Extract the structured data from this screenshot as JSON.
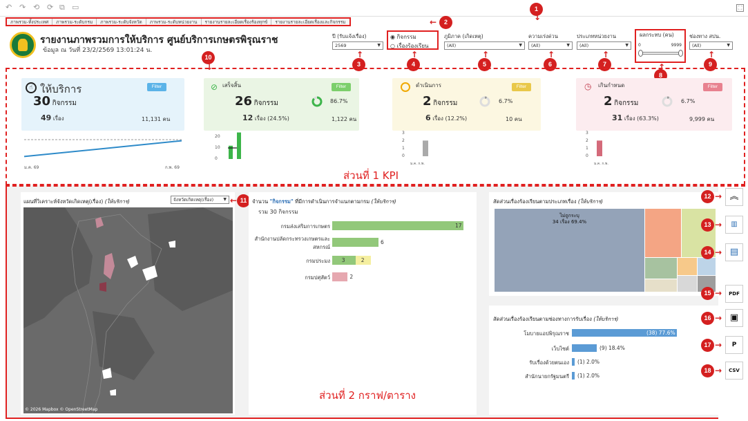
{
  "header": {
    "title": "รายงานภาพรวมการให้บริการ ศูนย์บริการเกษตรพิรุณราช",
    "subtitle": "ข้อมูล ณ วันที่ 23/2/2569 13:01:24 น."
  },
  "tabs": [
    "ภาพรวม-ทั้งประเทศ",
    "ภาพรวม-ระดับกรม",
    "ภาพรวม-ระดับจังหวัด",
    "ภาพรวม-ระดับหน่วยงาน",
    "รายงานรายละเอียดเรื่องร้องทุกข์",
    "รายงานรายละเอียดเรื่องและกิจกรรม"
  ],
  "filters": {
    "year": {
      "label": "ปี (รับแจ้งเรื่อง)",
      "value": "2569"
    },
    "type": {
      "opt1": "กิจกรรม",
      "opt2": "เรื่องร้องเรียน"
    },
    "region": {
      "label": "ภูมิภาค (เกิดเหตุ)",
      "value": "(All)"
    },
    "urgency": {
      "label": "ความเร่งด่วน",
      "value": "(All)"
    },
    "agency": {
      "label": "ประเภทหน่วยงาน",
      "value": "(All)"
    },
    "impact": {
      "label": "ผลกระทบ (คน)",
      "min": "0",
      "max": "9999"
    },
    "channel": {
      "label": "ช่องทาง สปน.",
      "value": "(All)"
    }
  },
  "badges": [
    "1",
    "2",
    "3",
    "4",
    "5",
    "6",
    "7",
    "8",
    "9",
    "10",
    "11",
    "12",
    "13",
    "14",
    "15",
    "16",
    "17",
    "18"
  ],
  "kpi": [
    {
      "title": "ให้บริการ",
      "filter": "Filter",
      "count": "30",
      "unit": "กิจกรรม",
      "stories": "49",
      "stories_unit": "เรื่อง",
      "people": "11,131 คน",
      "axis_start": "ม.ค. 69",
      "axis_end": "ก.พ. 69"
    },
    {
      "title": "เสร็จสิ้น",
      "filter": "Filter",
      "count": "26",
      "unit": "กิจกรรม",
      "pct": "86.7%",
      "stories": "12",
      "stories_unit": "เรื่อง",
      "stories_pct": "(24.5%)",
      "people": "1,122 คน",
      "yt": [
        "20",
        "10",
        "0"
      ]
    },
    {
      "title": "ดำเนินการ",
      "filter": "Filter",
      "count": "2",
      "unit": "กิจกรรม",
      "pct": "6.7%",
      "stories": "6",
      "stories_unit": "เรื่อง",
      "stories_pct": "(12.2%)",
      "people": "10 คน",
      "yt": [
        "3",
        "2",
        "1",
        "0"
      ],
      "xt": "ม.ค. ก.พ."
    },
    {
      "title": "เกินกำหนด",
      "filter": "Filter",
      "count": "2",
      "unit": "กิจกรรม",
      "pct": "6.7%",
      "stories": "31",
      "stories_unit": "เรื่อง",
      "stories_pct": "(63.3%)",
      "people": "9,999 คน",
      "yt": [
        "3",
        "2",
        "1",
        "0"
      ],
      "xt": "ม.ค. ก.พ."
    }
  ],
  "section1_label": "ส่วนที่ 1 KPI",
  "section2_label": "ส่วนที่ 2 กราฟ/ตาราง",
  "map": {
    "title": "แผนที่วิเคราะห์จังหวัดเกิดเหตุ(เรื่อง)",
    "title_i": "(ให้บริการ)",
    "select": "จังหวัดเกิดเหตุ(เรื่อง)",
    "credit": "© 2026 Mapbox  © OpenStreetMap"
  },
  "dept": {
    "title_a": "จำนวน",
    "title_b": "\"กิจกรรม\"",
    "title_c": "ที่มีการดำเนินการจำแนกตามกรม",
    "title_i": "(ให้บริการ)",
    "total": "รวม 30 กิจกรรม",
    "rows": [
      {
        "label": "กรมส่งเสริมการเกษตร",
        "a": "17",
        "b": ""
      },
      {
        "label": "สำนักงานปลัดกระทรวงเกษตรและสหกรณ์",
        "a": "6",
        "b": ""
      },
      {
        "label": "กรมประมง",
        "a": "3",
        "b": "2"
      },
      {
        "label": "กรมปศุสัตว์",
        "a": "2",
        "b": ""
      }
    ]
  },
  "treemap": {
    "title": "สัดส่วนเรื่องร้องเรียนตามประเภทเรื่อง",
    "title_i": "(ให้บริการ)",
    "label1": "ไม่ถูกระบุ",
    "label2": "34 เรื่อง 69.4%"
  },
  "channel": {
    "title": "สัดส่วนเรื่องร้องเรียนตามช่องทางการรับเรื่อง",
    "title_i": "(ให้บริการ)",
    "rows": [
      {
        "label": "โมบายแอปพิรุณราช",
        "val": "(38) 77.6%"
      },
      {
        "label": "เว็บไซต์",
        "val": "(9) 18.4%"
      },
      {
        "label": "รับเรื่องด้วยตนเอง",
        "val": "(1) 2.0%"
      },
      {
        "label": "สำนักนายกรัฐมนตรี",
        "val": "(1) 2.0%"
      }
    ]
  },
  "chart_data": [
    {
      "type": "line",
      "title": "",
      "x": [
        "ม.ค. 69",
        "ก.พ. 69"
      ],
      "series": [
        {
          "values": [
            1,
            4
          ]
        }
      ]
    },
    {
      "type": "bar",
      "title": "",
      "categories": [
        "ม.ค.",
        "ก.พ."
      ],
      "values": [
        12,
        26
      ],
      "ylim": [
        0,
        20
      ]
    },
    {
      "type": "bar",
      "title": "",
      "categories": [
        "ม.ค.",
        "ก.พ."
      ],
      "values": [
        0,
        2
      ],
      "ylim": [
        0,
        3
      ]
    },
    {
      "type": "bar",
      "title": "",
      "categories": [
        "ม.ค.",
        "ก.พ."
      ],
      "values": [
        2,
        0
      ],
      "ylim": [
        0,
        3
      ]
    },
    {
      "type": "bar",
      "title": "จำนวน \"กิจกรรม\" ที่มีการดำเนินการจำแนกตามกรม (ให้บริการ)",
      "categories": [
        "กรมส่งเสริมการเกษตร",
        "สำนักงานปลัดกระทรวงเกษตรและสหกรณ์",
        "กรมประมง",
        "กรมปศุสัตว์"
      ],
      "series": [
        {
          "values": [
            17,
            6,
            3,
            2
          ]
        },
        {
          "values": [
            0,
            0,
            2,
            0
          ]
        }
      ]
    },
    {
      "type": "bar",
      "title": "สัดส่วนเรื่องร้องเรียนตามช่องทางการรับเรื่อง (ให้บริการ)",
      "categories": [
        "โมบายแอปพิรุณราช",
        "เว็บไซต์",
        "รับเรื่องด้วยตนเอง",
        "สำนักนายกรัฐมนตรี"
      ],
      "values": [
        38,
        9,
        1,
        1
      ]
    }
  ],
  "colors": {
    "accent_red": "#d42020",
    "green": "#3db54a",
    "orange": "#f0a800",
    "pink": "#d46a7a",
    "blue": "#4a8fc9",
    "teal_bar": "#5b9bd5"
  }
}
